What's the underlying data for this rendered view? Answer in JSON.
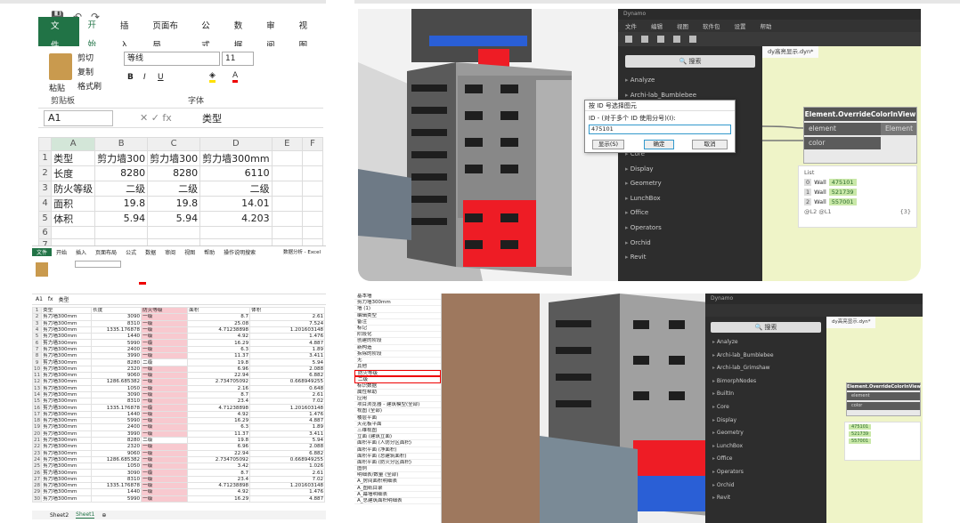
{
  "excel_top": {
    "tabs": [
      "文件",
      "开始",
      "插入",
      "页面布局",
      "公式",
      "数据",
      "审阅",
      "视图"
    ],
    "clipboard": {
      "paste": "粘贴",
      "cut": "剪切",
      "copy": "复制",
      "format_painter": "格式刷",
      "group": "剪贴板"
    },
    "font": {
      "name": "等线",
      "size": "11",
      "group": "字体"
    },
    "name_box": "A1",
    "formula": "类型",
    "columns": [
      "A",
      "B",
      "C",
      "D",
      "E",
      "F"
    ],
    "rows": [
      {
        "n": "1",
        "a": "类型",
        "b": "剪力墙300",
        "c": "剪力墙300",
        "d": "剪力墙300mm",
        "e": ""
      },
      {
        "n": "2",
        "a": "长度",
        "b": "8280",
        "c": "8280",
        "d": "6110",
        "e": ""
      },
      {
        "n": "3",
        "a": "防火等级",
        "b": "二级",
        "c": "二级",
        "d": "二级",
        "e": ""
      },
      {
        "n": "4",
        "a": "面积",
        "b": "19.8",
        "c": "19.8",
        "d": "14.01",
        "e": ""
      },
      {
        "n": "5",
        "a": "体积",
        "b": "5.94",
        "c": "5.94",
        "d": "4.203",
        "e": ""
      },
      {
        "n": "6",
        "a": "",
        "b": "",
        "c": "",
        "d": "",
        "e": ""
      },
      {
        "n": "7",
        "a": "",
        "b": "",
        "c": "",
        "d": "",
        "e": ""
      }
    ]
  },
  "excel_bottom": {
    "tabs": [
      "文件",
      "开始",
      "插入",
      "页面布局",
      "公式",
      "数据",
      "审阅",
      "视图",
      "帮助",
      "操作说明搜索"
    ],
    "title": "数据分析 - Excel",
    "name_box": "A1",
    "formula": "类型",
    "headers": [
      "类型",
      "长度",
      "防火等级",
      "面积",
      "体积"
    ],
    "rows": [
      [
        "剪力墙300mm",
        "3090",
        "一级",
        "8.7",
        "2.61"
      ],
      [
        "剪力墙300mm",
        "8310",
        "一级",
        "25.08",
        "7.524"
      ],
      [
        "剪力墙300mm",
        "1335.176878",
        "一级",
        "4.71238898",
        "1.201603148"
      ],
      [
        "剪力墙300mm",
        "1440",
        "一级",
        "4.92",
        "1.476"
      ],
      [
        "剪力墙300mm",
        "5990",
        "一级",
        "16.29",
        "4.887"
      ],
      [
        "剪力墙300mm",
        "2400",
        "一级",
        "6.3",
        "1.89"
      ],
      [
        "剪力墙300mm",
        "3990",
        "一级",
        "11.37",
        "3.411"
      ],
      [
        "剪力墙300mm",
        "8280",
        "二级",
        "19.8",
        "5.94"
      ],
      [
        "剪力墙300mm",
        "2320",
        "一级",
        "6.96",
        "2.088"
      ],
      [
        "剪力墙300mm",
        "9060",
        "一级",
        "22.94",
        "6.882"
      ],
      [
        "剪力墙300mm",
        "1286.685382",
        "一级",
        "2.734705092",
        "0.668949255"
      ],
      [
        "剪力墙300mm",
        "1050",
        "一级",
        "2.16",
        "0.648"
      ],
      [
        "剪力墙300mm",
        "3090",
        "一级",
        "8.7",
        "2.61"
      ],
      [
        "剪力墙300mm",
        "8310",
        "一级",
        "23.4",
        "7.02"
      ],
      [
        "剪力墙300mm",
        "1335.176878",
        "一级",
        "4.71238898",
        "1.201603148"
      ],
      [
        "剪力墙300mm",
        "1440",
        "一级",
        "4.92",
        "1.476"
      ],
      [
        "剪力墙300mm",
        "5990",
        "一级",
        "16.29",
        "4.887"
      ],
      [
        "剪力墙300mm",
        "2400",
        "一级",
        "6.3",
        "1.89"
      ],
      [
        "剪力墙300mm",
        "3990",
        "一级",
        "11.37",
        "3.411"
      ],
      [
        "剪力墙300mm",
        "8280",
        "二级",
        "19.8",
        "5.94"
      ],
      [
        "剪力墙300mm",
        "2320",
        "一级",
        "6.96",
        "2.088"
      ],
      [
        "剪力墙300mm",
        "9060",
        "一级",
        "22.94",
        "6.882"
      ],
      [
        "剪力墙300mm",
        "1286.685382",
        "一级",
        "2.734705092",
        "0.668949255"
      ],
      [
        "剪力墙300mm",
        "1050",
        "一级",
        "3.42",
        "1.026"
      ],
      [
        "剪力墙300mm",
        "3090",
        "一级",
        "8.7",
        "2.61"
      ],
      [
        "剪力墙300mm",
        "8310",
        "一级",
        "23.4",
        "7.02"
      ],
      [
        "剪力墙300mm",
        "1335.176878",
        "一级",
        "4.71238898",
        "1.201603148"
      ],
      [
        "剪力墙300mm",
        "1440",
        "一级",
        "4.92",
        "1.476"
      ],
      [
        "剪力墙300mm",
        "5990",
        "一级",
        "16.29",
        "4.887"
      ]
    ],
    "sheets": [
      "Sheet2",
      "Sheet1"
    ]
  },
  "dynamo_top": {
    "title": "Dynamo",
    "menu": [
      "文件",
      "编辑",
      "视图",
      "软件包",
      "设置",
      "帮助"
    ],
    "tab": "dy高亮显示.dyn*",
    "search": "搜索",
    "library": [
      "Analyze",
      "Archi-lab_Bumblebee",
      "Archi-lab_Grimshaw",
      "BimorphNodes",
      "BuiltIn",
      "Core",
      "Display",
      "Geometry",
      "LunchBox",
      "Office",
      "Operators",
      "Orchid",
      "Revit"
    ],
    "node": {
      "title": "Element.OverrideColorInView",
      "in1": "element",
      "in2": "color",
      "out": "Element"
    },
    "watch": {
      "title": "List",
      "items": [
        {
          "i": "0",
          "t": "Wall",
          "id": "475101"
        },
        {
          "i": "1",
          "t": "Wall",
          "id": "521739"
        },
        {
          "i": "2",
          "t": "Wall",
          "id": "557001"
        }
      ],
      "footer": "@L2 @L1",
      "count": "{3}"
    }
  },
  "dialog": {
    "title": "按 ID 号选择图元",
    "label": "ID - (对于多个 ID 使用分号)(I):",
    "value": "475101",
    "show": "显示(S)",
    "ok": "确定",
    "cancel": "取消"
  },
  "revit_bottom": {
    "props": [
      "基本墙",
      "剪力墙300mm",
      "墙 (1)",
      "编辑类型",
      "备注",
      "标记",
      "阶段化",
      "创建的阶段",
      "新构造",
      "拆除的阶段",
      "无",
      "其他",
      "防火等级",
      "二级",
      "标识数据",
      "属性帮助",
      "应用",
      "项目浏览器 - 建筑模型(全部)",
      "视图 (全部)",
      "楼层平面",
      "天花板平面",
      "三维视图",
      "立面 (建筑立面)",
      "面积平面 (人防分区面积)",
      "面积平面 (净面积)",
      "面积平面 (总建筑面积)",
      "面积平面 (防火分区面积)",
      "图例",
      "明细表/数量 (全部)",
      "A_房间面积明细表",
      "A_图纸目录",
      "A_幕墙明细表",
      "A_总建筑面积明细表"
    ]
  },
  "dynamo_bottom": {
    "title": "Dynamo",
    "tab": "dy高亮显示.dyn*",
    "search": "搜索",
    "library": [
      "Analyze",
      "Archi-lab_Bumblebee",
      "Archi-lab_Grimshaw",
      "BimorphNodes",
      "BuiltIn",
      "Core",
      "Display",
      "Geometry",
      "LunchBox",
      "Office",
      "Operators",
      "Orchid",
      "Revit"
    ],
    "node": "Element.OverrideColorInView",
    "watch": [
      "475101",
      "521739",
      "557001"
    ]
  },
  "colors": {
    "excel_green": "#217346",
    "highlight_red": "#ee1c25",
    "highlight_blue": "#2a5fd6",
    "dynamo_canvas": "#eff4c8",
    "pink": "#f8c9cf"
  }
}
